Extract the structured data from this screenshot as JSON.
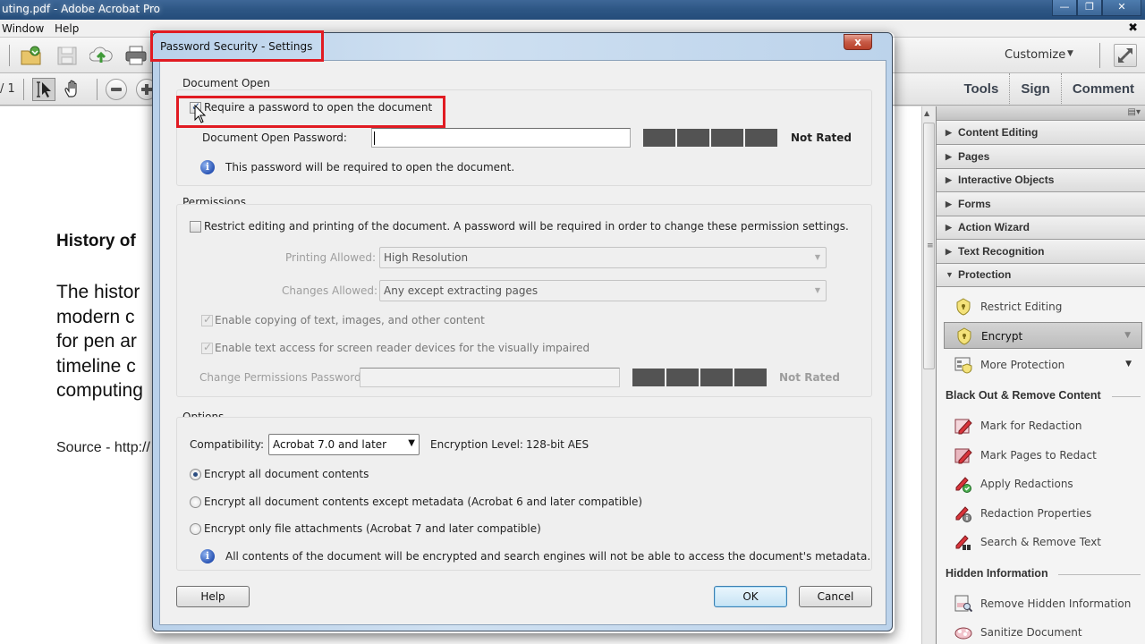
{
  "app": {
    "window_title": "uting.pdf - Adobe Acrobat Pro",
    "window_buttons": {
      "minimize": "—",
      "restore": "❐",
      "close": "✕"
    },
    "menu": [
      "Window",
      "Help"
    ],
    "doc_close": "✖"
  },
  "toolbar": {
    "customize_label": "Customize",
    "page_indicator": "/ 1",
    "pane_tabs": [
      "Tools",
      "Sign",
      "Comment"
    ]
  },
  "document": {
    "heading": "History of",
    "body_lines": [
      "The histor",
      "modern  c",
      "for pen ar",
      "timeline  c",
      "computing"
    ],
    "source": "Source - http://"
  },
  "right_pane": {
    "panels": [
      "Content Editing",
      "Pages",
      "Interactive Objects",
      "Forms",
      "Action Wizard",
      "Text Recognition",
      "Protection"
    ],
    "protection_items": [
      {
        "label": "Restrict Editing",
        "icon": "shield-icon"
      },
      {
        "label": "Encrypt",
        "icon": "shield-icon",
        "selected": true
      },
      {
        "label": "More Protection",
        "icon": "certificate-icon"
      }
    ],
    "black_out_header": "Black Out & Remove Content",
    "black_out_items": [
      {
        "label": "Mark for Redaction",
        "icon": "redaction-marker-icon"
      },
      {
        "label": "Mark Pages to Redact",
        "icon": "redaction-pages-icon"
      },
      {
        "label": "Apply Redactions",
        "icon": "apply-redactions-icon"
      },
      {
        "label": "Redaction Properties",
        "icon": "redaction-properties-icon"
      },
      {
        "label": "Search & Remove Text",
        "icon": "search-remove-text-icon"
      }
    ],
    "hidden_info_header": "Hidden Information",
    "hidden_info_items": [
      {
        "label": "Remove Hidden Information",
        "icon": "remove-hidden-info-icon"
      },
      {
        "label": "Sanitize Document",
        "icon": "sanitize-icon"
      }
    ]
  },
  "dialog": {
    "title": "Password Security - Settings",
    "close": "x",
    "document_open": {
      "section_title": "Document Open",
      "require_password_label": "Require a password to open the document",
      "require_password_checked": true,
      "password_label": "Document Open Password:",
      "password_value": "",
      "strength_rating": "Not Rated",
      "info_text": "This password will be required to open the document."
    },
    "permissions": {
      "section_title": "Permissions",
      "restrict_label": "Restrict editing and printing of the document. A password will be required in order to change these permission settings.",
      "restrict_checked": false,
      "printing_label": "Printing Allowed:",
      "printing_value": "High Resolution",
      "changes_label": "Changes Allowed:",
      "changes_value": "Any except extracting pages",
      "enable_copy_label": "Enable copying of text, images, and other content",
      "enable_copy_checked": true,
      "enable_access_label": "Enable text access for screen reader devices for the visually impaired",
      "enable_access_checked": true,
      "change_pw_label": "Change Permissions Password:",
      "change_pw_value": "",
      "strength_rating": "Not Rated"
    },
    "options": {
      "section_title": "Options",
      "compat_label": "Compatibility:",
      "compat_value": "Acrobat 7.0 and later",
      "encryption_label": "Encryption  Level:",
      "encryption_value": "128-bit AES",
      "radio_options": [
        "Encrypt all document contents",
        "Encrypt all document contents except metadata (Acrobat 6 and later compatible)",
        "Encrypt only file attachments (Acrobat 7 and later compatible)"
      ],
      "selected_radio": 0,
      "info_text": "All contents of the document will be encrypted and search engines will not be able to access the document's metadata."
    },
    "buttons": {
      "help": "Help",
      "ok": "OK",
      "cancel": "Cancel"
    }
  },
  "colors": {
    "highlight": "#e11b22",
    "title_bar": "#2d5684",
    "strength_meter": "#535353"
  }
}
